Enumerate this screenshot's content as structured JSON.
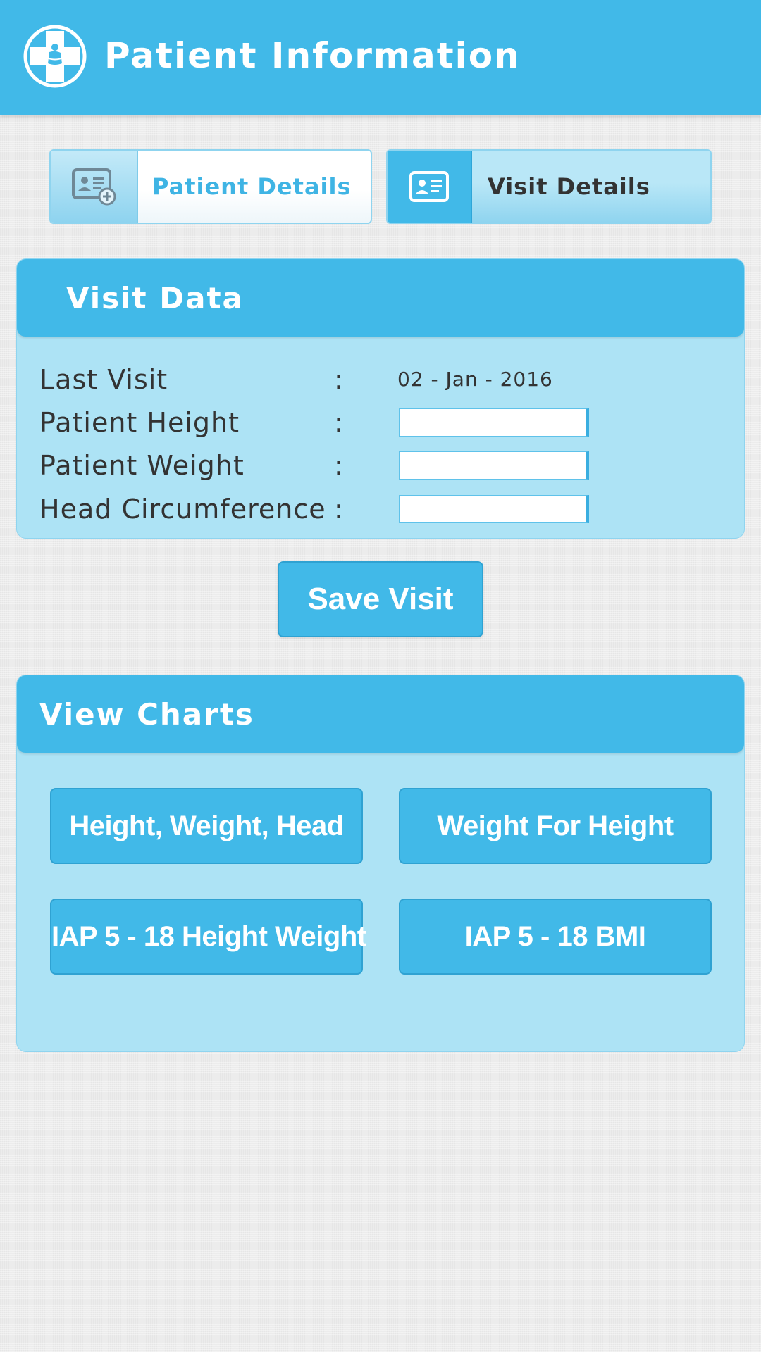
{
  "header": {
    "title": "Patient Information",
    "logo_icon": "medical-cross-icon",
    "background_color": "#41b9e8"
  },
  "tabs": [
    {
      "label": "Patient Details",
      "icon": "add-user-card-icon",
      "active": false
    },
    {
      "label": "Visit Details",
      "icon": "id-card-icon",
      "active": true
    }
  ],
  "visit_data": {
    "title": "Visit Data",
    "fields": [
      {
        "label": "Last Visit",
        "separator": ":",
        "value": "02 - Jan - 2016"
      },
      {
        "label": "Patient Height",
        "separator": ":",
        "value": ""
      },
      {
        "label": "Patient Weight",
        "separator": ":",
        "value": ""
      },
      {
        "label": "Head Circumference",
        "separator": ":",
        "value": ""
      }
    ]
  },
  "save_button": {
    "label": "Save Visit"
  },
  "charts": {
    "title": "View Charts",
    "buttons": [
      {
        "label": "Height, Weight, Head"
      },
      {
        "label": "Weight For Height"
      },
      {
        "label": "IAP 5  - 18 Height Weight"
      },
      {
        "label": "IAP 5  - 18 BMI"
      }
    ]
  },
  "colors": {
    "accent": "#41b9e8",
    "panel": "#ade3f5",
    "text": "#333333",
    "background": "#ececec"
  }
}
